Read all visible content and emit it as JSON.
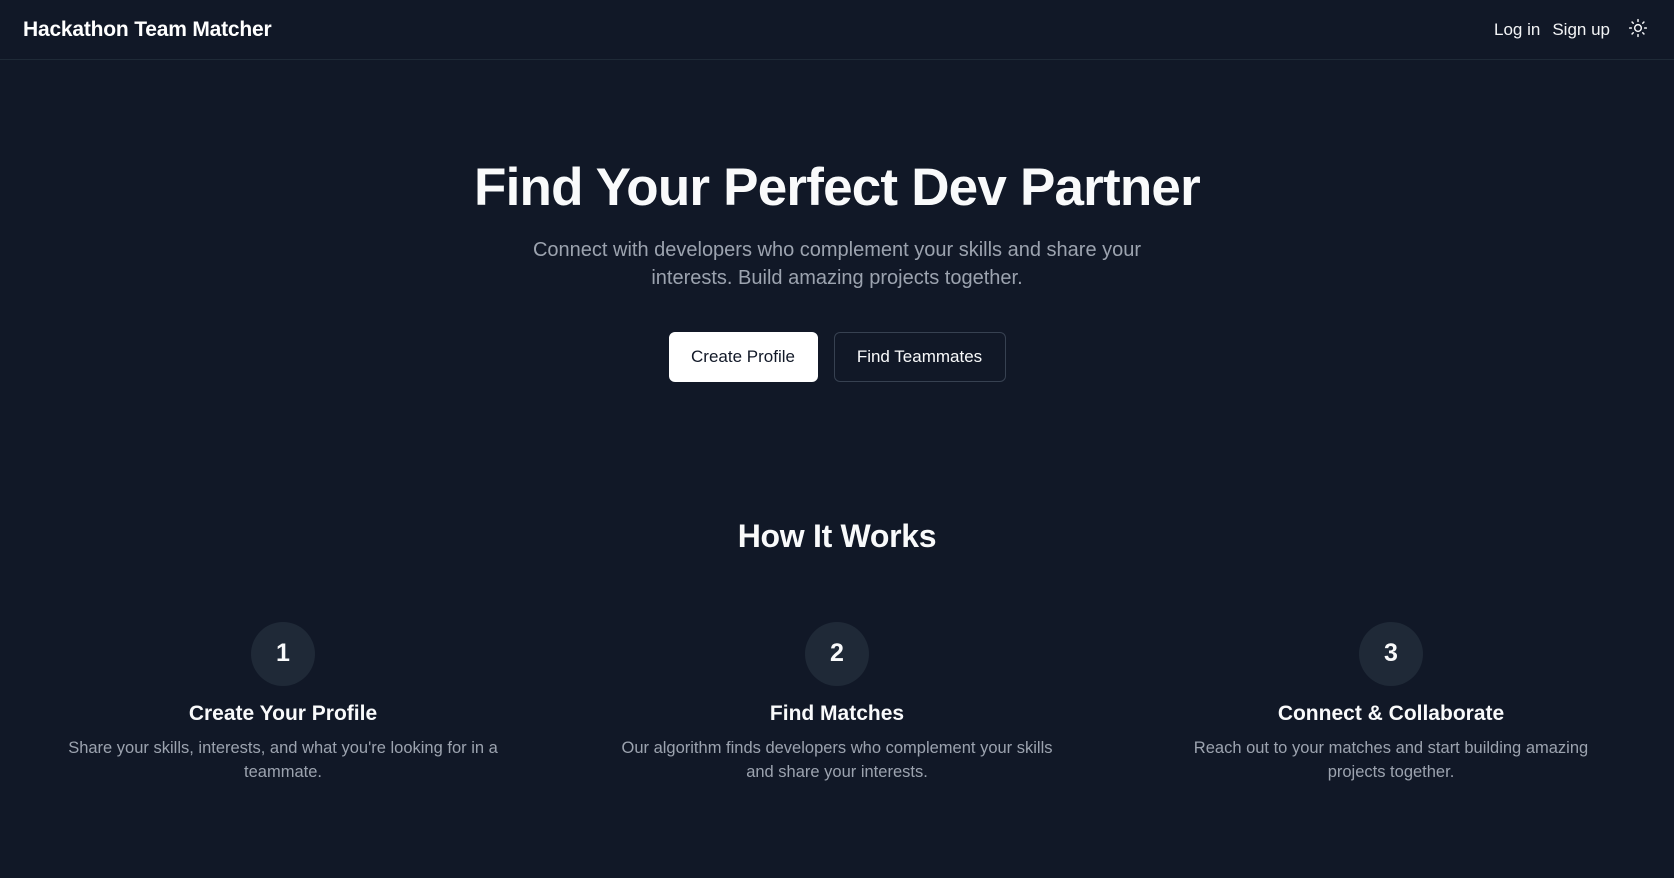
{
  "header": {
    "brand": "Hackathon Team Matcher",
    "login_label": "Log in",
    "signup_label": "Sign up",
    "theme_icon": "sun-icon"
  },
  "hero": {
    "title": "Find Your Perfect Dev Partner",
    "subtitle": "Connect with developers who complement your skills and share your interests. Build amazing projects together.",
    "primary_cta": "Create Profile",
    "secondary_cta": "Find Teammates"
  },
  "how_it_works": {
    "title": "How It Works",
    "steps": [
      {
        "number": "1",
        "title": "Create Your Profile",
        "description": "Share your skills, interests, and what you're looking for in a teammate."
      },
      {
        "number": "2",
        "title": "Find Matches",
        "description": "Our algorithm finds developers who complement your skills and share your interests."
      },
      {
        "number": "3",
        "title": "Connect & Collaborate",
        "description": "Reach out to your matches and start building amazing projects together."
      }
    ]
  },
  "colors": {
    "background": "#111827",
    "text": "#f9fafb",
    "muted": "#9ca3af",
    "surface": "#1f2937",
    "border": "#374151"
  }
}
